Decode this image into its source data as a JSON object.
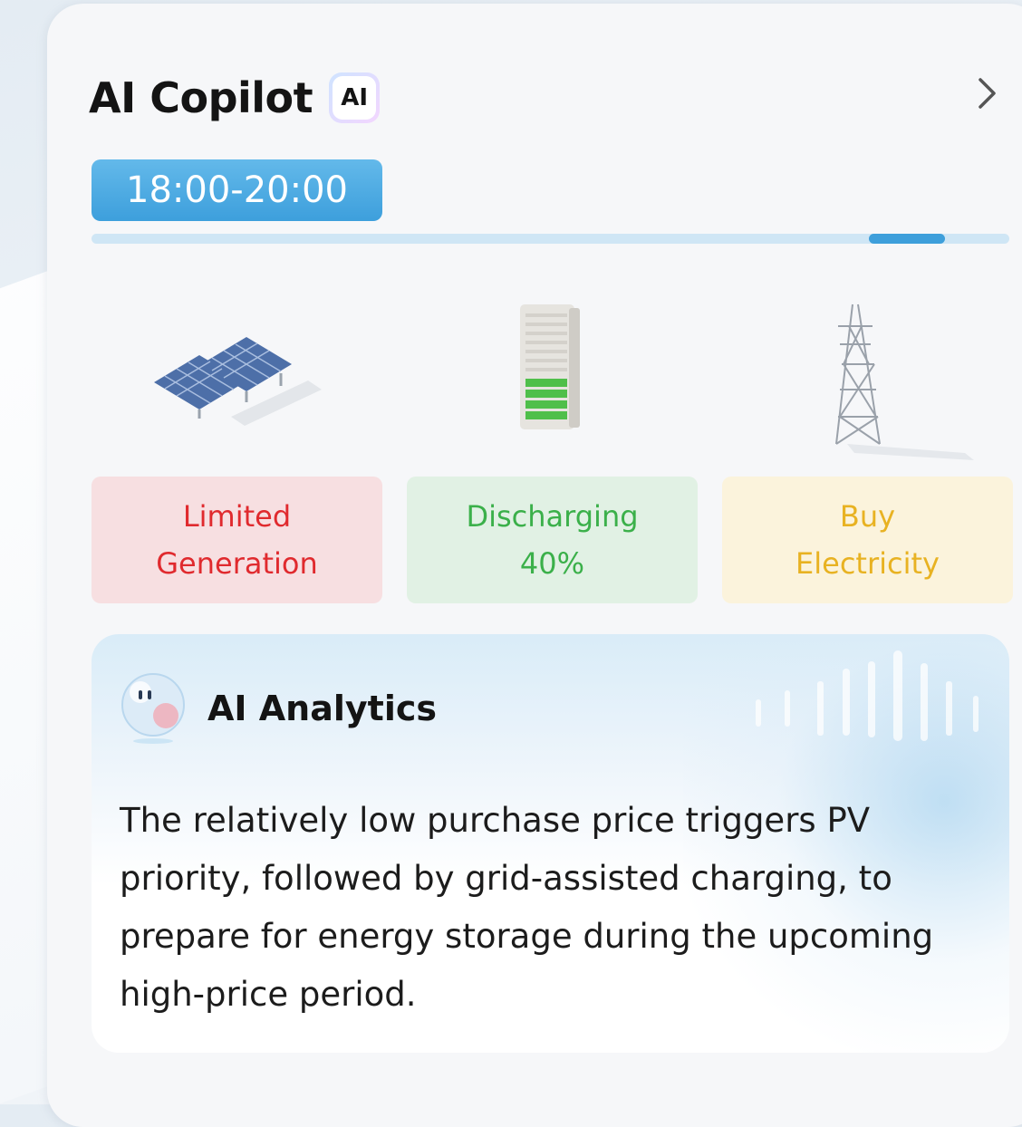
{
  "header": {
    "title": "AI Copilot",
    "badge": "AI"
  },
  "timeline": {
    "time_range": "18:00-20:00",
    "progress_start": 0.847,
    "progress_end": 0.93
  },
  "devices": [
    {
      "icon": "solar-panel-icon",
      "status_line1": "Limited",
      "status_line2": "Generation",
      "color": "#e02a2e"
    },
    {
      "icon": "battery-storage-icon",
      "status_line1": "Discharging",
      "status_line2": "40%",
      "color": "#3bb04a"
    },
    {
      "icon": "power-tower-icon",
      "status_line1": "Buy",
      "status_line2": "Electricity",
      "color": "#e8b222"
    }
  ],
  "analytics": {
    "title": "AI Analytics",
    "text": "The relatively low purchase price triggers PV priority, followed by grid-assisted charging, to prepare for energy storage during the upcoming high-price period."
  },
  "colors": {
    "accent": "#3e9fdb",
    "card_bg": "#f6f7f9"
  }
}
